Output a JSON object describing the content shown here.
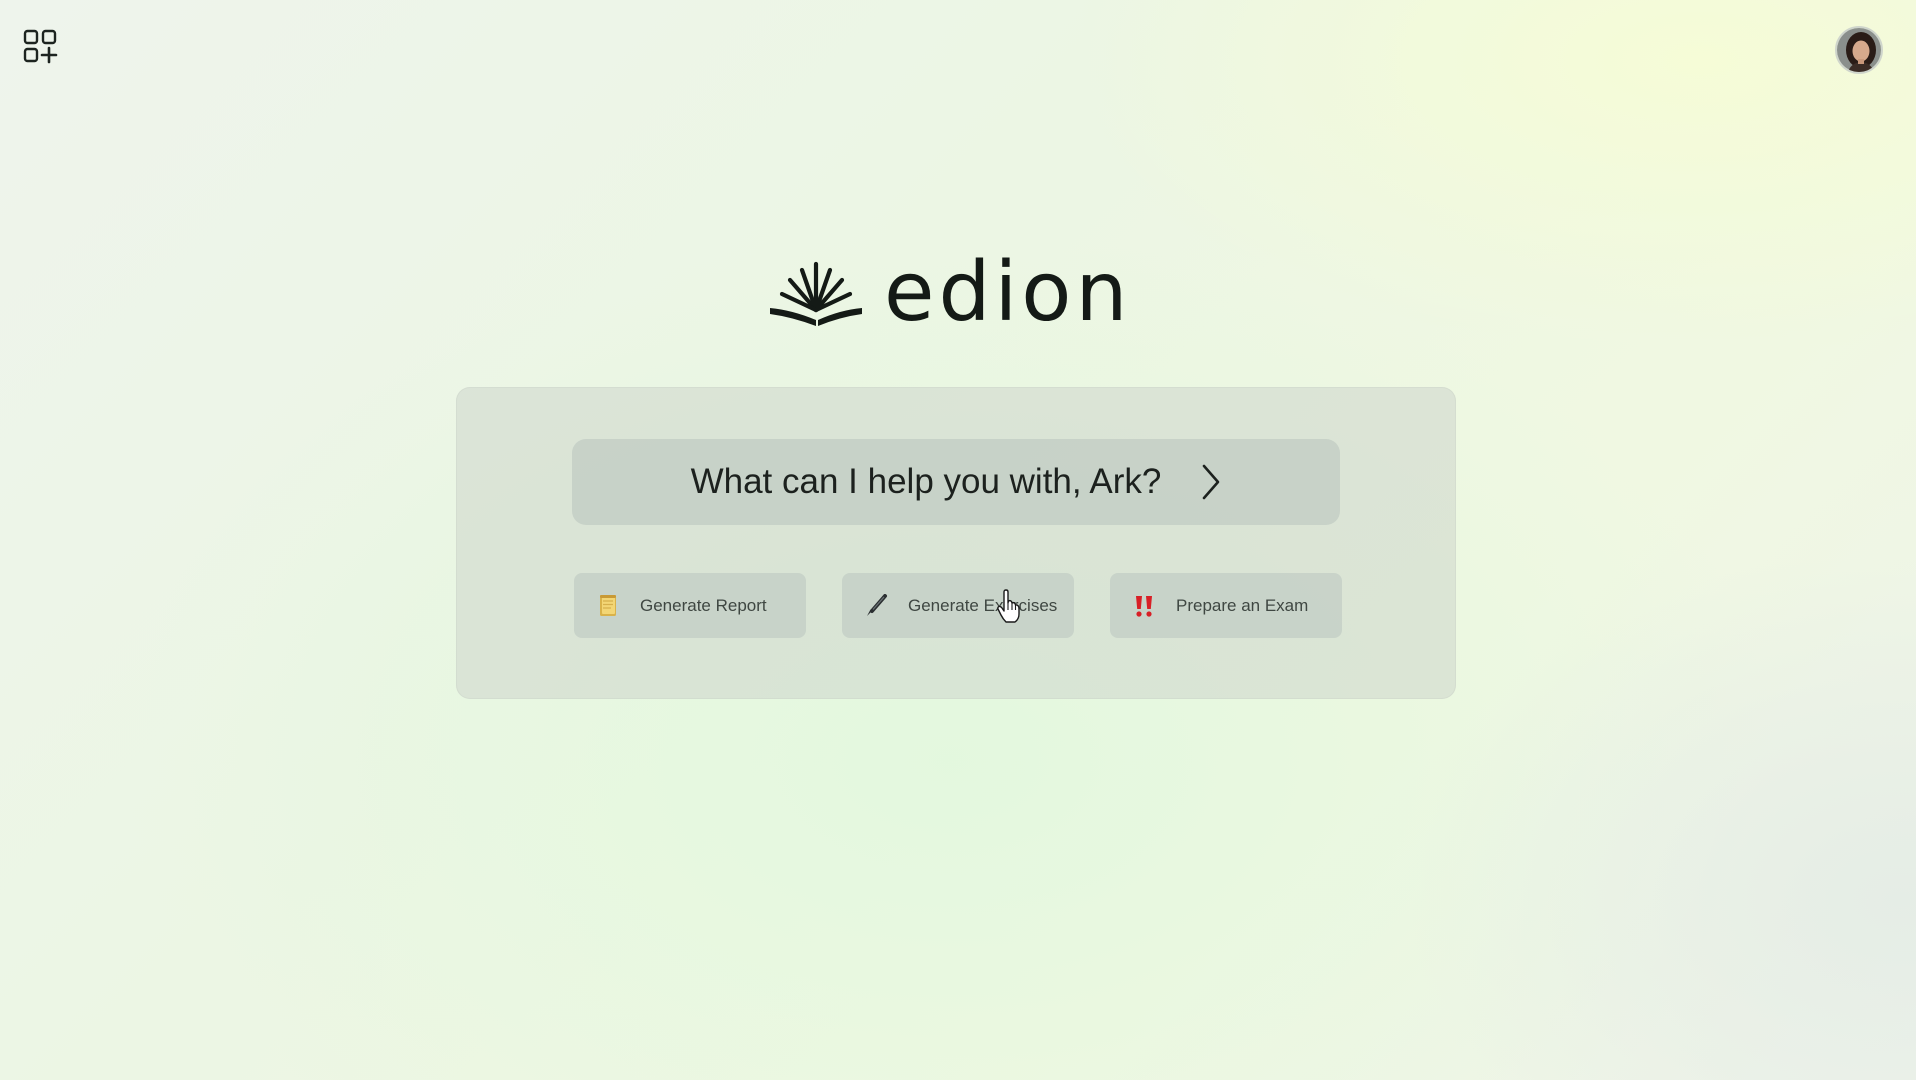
{
  "brand": {
    "name": "edion",
    "mark_icon": "open-book-rays-logo"
  },
  "header": {
    "apps_icon": "apps-grid-plus-icon",
    "avatar": "user-avatar"
  },
  "prompt": {
    "text": "What can I help you with, Ark?",
    "submit_icon": "chevron-right-icon"
  },
  "actions": [
    {
      "label": "Generate Report",
      "icon": "notepad-icon"
    },
    {
      "label": "Generate Exercises",
      "icon": "pen-icon"
    },
    {
      "label": "Prepare an Exam",
      "icon": "double-exclamation-icon"
    }
  ],
  "colors": {
    "text_dark": "#141a16",
    "chip_text": "#3f4742",
    "exclamation_red": "#d81f26"
  }
}
